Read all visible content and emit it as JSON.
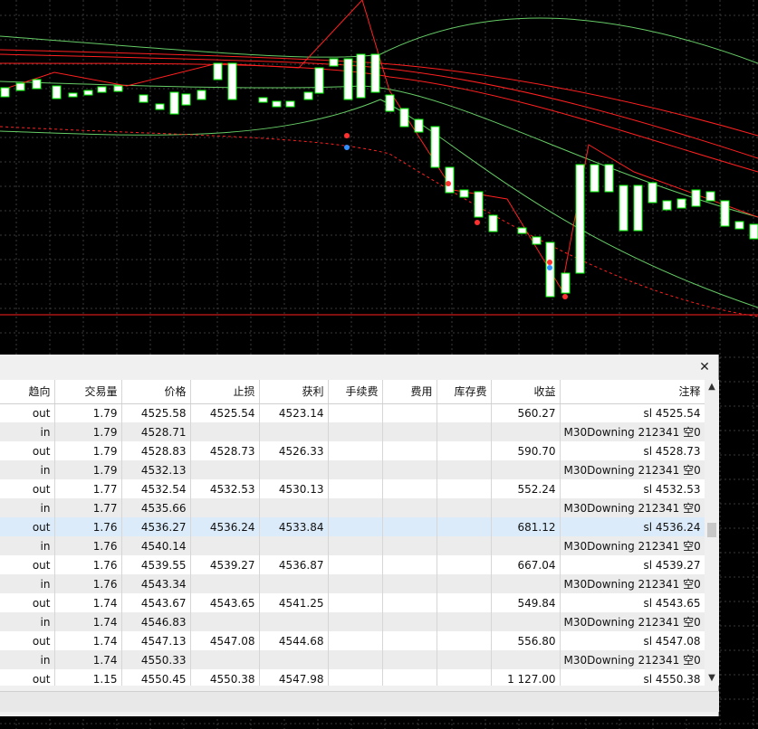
{
  "colors": {
    "background": "#000000",
    "grid": "#3a3a3a",
    "bull_candle": "#ffffff",
    "candle_outline": "#00ff00",
    "bollinger": "#66cc66",
    "moving_avg": "#ff2020",
    "selected_row": "#dcebfa",
    "alt_row": "#ececec"
  },
  "trades_panel": {
    "close_label": "✕",
    "columns": [
      "趋向",
      "交易量",
      "价格",
      "止损",
      "获利",
      "手续费",
      "费用",
      "库存费",
      "收益",
      "注释"
    ],
    "rows": [
      {
        "dir": "out",
        "vol": "1.79",
        "price": "4525.58",
        "sl": "4525.54",
        "tp": "4523.14",
        "commission": "",
        "fee": "",
        "swap": "",
        "profit": "560.27",
        "comment": "sl 4525.54"
      },
      {
        "dir": "in",
        "vol": "1.79",
        "price": "4528.71",
        "sl": "",
        "tp": "",
        "commission": "",
        "fee": "",
        "swap": "",
        "profit": "",
        "comment": "M30Downing 212341 空0"
      },
      {
        "dir": "out",
        "vol": "1.79",
        "price": "4528.83",
        "sl": "4528.73",
        "tp": "4526.33",
        "commission": "",
        "fee": "",
        "swap": "",
        "profit": "590.70",
        "comment": "sl 4528.73"
      },
      {
        "dir": "in",
        "vol": "1.79",
        "price": "4532.13",
        "sl": "",
        "tp": "",
        "commission": "",
        "fee": "",
        "swap": "",
        "profit": "",
        "comment": "M30Downing 212341 空0"
      },
      {
        "dir": "out",
        "vol": "1.77",
        "price": "4532.54",
        "sl": "4532.53",
        "tp": "4530.13",
        "commission": "",
        "fee": "",
        "swap": "",
        "profit": "552.24",
        "comment": "sl 4532.53"
      },
      {
        "dir": "in",
        "vol": "1.77",
        "price": "4535.66",
        "sl": "",
        "tp": "",
        "commission": "",
        "fee": "",
        "swap": "",
        "profit": "",
        "comment": "M30Downing 212341 空0"
      },
      {
        "dir": "out",
        "vol": "1.76",
        "price": "4536.27",
        "sl": "4536.24",
        "tp": "4533.84",
        "commission": "",
        "fee": "",
        "swap": "",
        "profit": "681.12",
        "comment": "sl 4536.24"
      },
      {
        "dir": "in",
        "vol": "1.76",
        "price": "4540.14",
        "sl": "",
        "tp": "",
        "commission": "",
        "fee": "",
        "swap": "",
        "profit": "",
        "comment": "M30Downing 212341 空0"
      },
      {
        "dir": "out",
        "vol": "1.76",
        "price": "4539.55",
        "sl": "4539.27",
        "tp": "4536.87",
        "commission": "",
        "fee": "",
        "swap": "",
        "profit": "667.04",
        "comment": "sl 4539.27"
      },
      {
        "dir": "in",
        "vol": "1.76",
        "price": "4543.34",
        "sl": "",
        "tp": "",
        "commission": "",
        "fee": "",
        "swap": "",
        "profit": "",
        "comment": "M30Downing 212341 空0"
      },
      {
        "dir": "out",
        "vol": "1.74",
        "price": "4543.67",
        "sl": "4543.65",
        "tp": "4541.25",
        "commission": "",
        "fee": "",
        "swap": "",
        "profit": "549.84",
        "comment": "sl 4543.65"
      },
      {
        "dir": "in",
        "vol": "1.74",
        "price": "4546.83",
        "sl": "",
        "tp": "",
        "commission": "",
        "fee": "",
        "swap": "",
        "profit": "",
        "comment": "M30Downing 212341 空0"
      },
      {
        "dir": "out",
        "vol": "1.74",
        "price": "4547.13",
        "sl": "4547.08",
        "tp": "4544.68",
        "commission": "",
        "fee": "",
        "swap": "",
        "profit": "556.80",
        "comment": "sl 4547.08"
      },
      {
        "dir": "in",
        "vol": "1.74",
        "price": "4550.33",
        "sl": "",
        "tp": "",
        "commission": "",
        "fee": "",
        "swap": "",
        "profit": "",
        "comment": "M30Downing 212341 空0"
      },
      {
        "dir": "out",
        "vol": "1.15",
        "price": "4550.45",
        "sl": "4550.38",
        "tp": "4547.98",
        "commission": "",
        "fee": "",
        "swap": "",
        "profit": "1 127.00",
        "comment": "sl 4550.38"
      }
    ],
    "selected_row": 6,
    "scroll_up": "▲",
    "scroll_down": "▼"
  }
}
